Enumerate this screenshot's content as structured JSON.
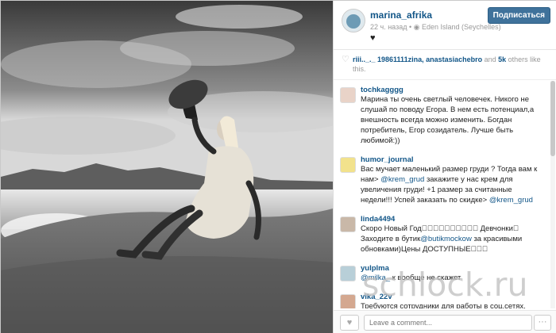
{
  "post": {
    "username": "marina_afrika",
    "time_ago": "22 ч. назад",
    "location": "Eden Island (Seychelles)",
    "follow_label": "Подписаться"
  },
  "likes": {
    "names": "riii.._._ 19861111zina, anastasiachebro",
    "and": " and ",
    "count": "5k",
    "suffix": " others like this."
  },
  "comments": [
    {
      "user": "tochkagggg",
      "text": "Марина ты очень светлый человечек. Никого не слушай по поводу Егора. В нем есть потенциал,а внешность всегда можно изменить. Богдан потребитель, Егор созидатель. Лучше быть любимой:))",
      "avatar_color": "#e9d3c8"
    },
    {
      "user": "humor_journal",
      "text_parts": [
        {
          "t": "Вас мучает маленький размер груди ? Тогда вам к нам> "
        },
        {
          "t": "@krem_grud",
          "m": true
        },
        {
          "t": " закажите у нас крем для увеличения груди! +1 размер за считанные недели!!! Успей заказать по скидке> "
        },
        {
          "t": "@krem_grud",
          "m": true
        }
      ],
      "avatar_color": "#f2e28c"
    },
    {
      "user": "linda4494",
      "text_parts": [
        {
          "t": "Скоро Новый Год󾓜󾓜󾓜󾓜󾓜󾓜󾓜󾓜󾓜󾓜 Девчонки󾓜 Заходите в бутик"
        },
        {
          "t": "@butikmockow",
          "m": true
        },
        {
          "t": " за красивыми обновками)Цены ДОСТУПНЫЕ󾓜󾓜󾓜"
        }
      ],
      "avatar_color": "#c9b8a8"
    },
    {
      "user": "yulplma",
      "text_parts": [
        {
          "t": "@milka_",
          "m": true
        },
        {
          "t": " к вообще не скажет"
        }
      ],
      "avatar_color": "#b8cfd8"
    },
    {
      "user": "vika_22v",
      "text": "Требуются сотрудники для работы в соц.сетях.",
      "avatar_color": "#d4a890"
    }
  ],
  "footer": {
    "comment_placeholder": "Leave a comment...",
    "more_label": "···"
  },
  "watermark": "schlock.ru",
  "colors": {
    "link": "#125688",
    "follow_button": "#3f729b"
  },
  "icons": [
    "location-icon",
    "heart-icon",
    "more-icon"
  ]
}
